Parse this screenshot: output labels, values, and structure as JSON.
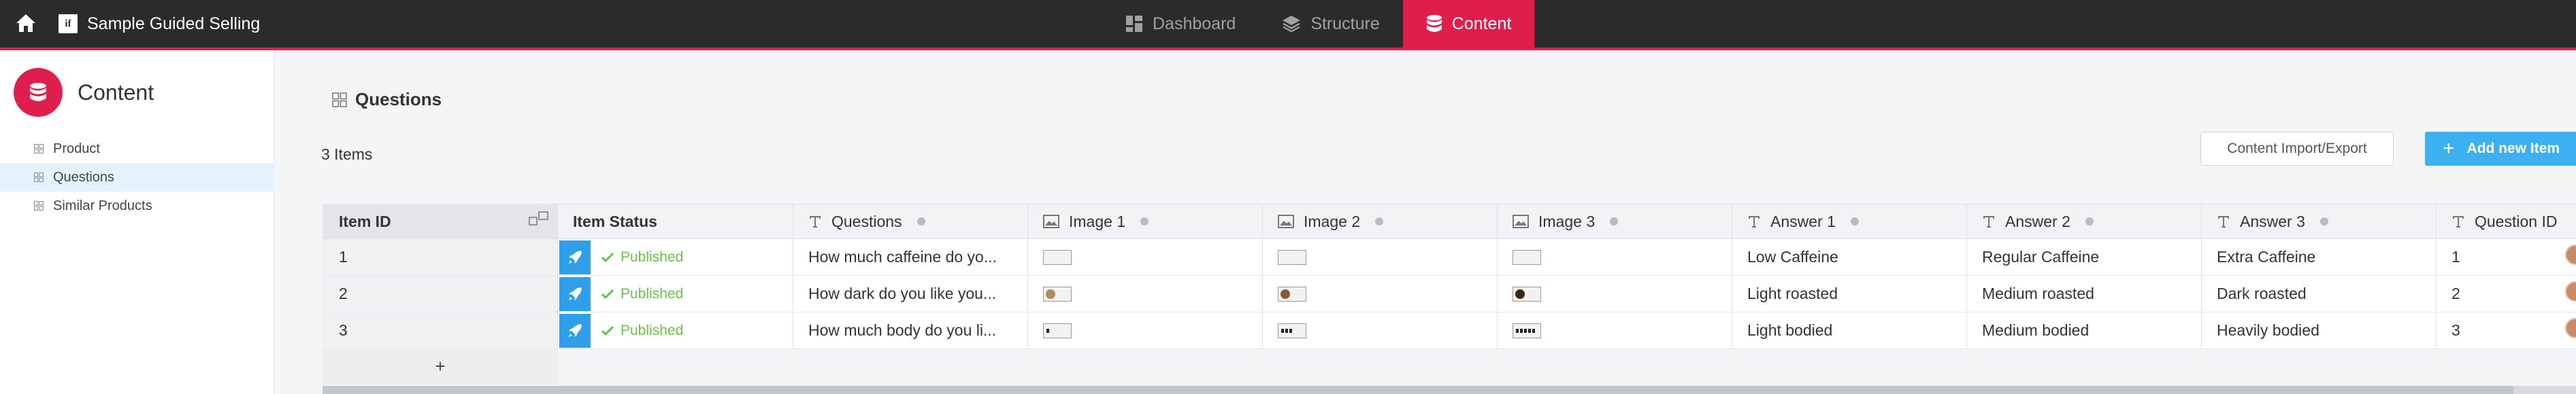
{
  "topbar": {
    "app_logo": "if",
    "app_title": "Sample Guided Selling",
    "nav": [
      {
        "label": "Dashboard",
        "icon": "dashboard-icon"
      },
      {
        "label": "Structure",
        "icon": "layers-icon"
      },
      {
        "label": "Content",
        "icon": "database-icon",
        "active": true
      }
    ]
  },
  "sidebar": {
    "title": "Content",
    "items": [
      {
        "label": "Product"
      },
      {
        "label": "Questions",
        "active": true
      },
      {
        "label": "Similar Products"
      }
    ]
  },
  "main": {
    "title": "Questions",
    "count": "3 Items",
    "import_button": "Content Import/Export",
    "add_button": "Add new Item"
  },
  "table": {
    "columns": [
      "Item ID",
      "Item Status",
      "Questions",
      "Image 1",
      "Image 2",
      "Image 3",
      "Answer 1",
      "Answer 2",
      "Answer 3",
      "Question ID"
    ],
    "rows": [
      {
        "id": "1",
        "status": "Published",
        "question": "How much caffeine do yo...",
        "a1": "Low Caffeine",
        "a2": "Regular Caffeine",
        "a3": "Extra Caffeine",
        "qid": "1"
      },
      {
        "id": "2",
        "status": "Published",
        "question": "How dark do you like you...",
        "a1": "Light roasted",
        "a2": "Medium roasted",
        "a3": "Dark roasted",
        "qid": "2"
      },
      {
        "id": "3",
        "status": "Published",
        "question": "How much body do you li...",
        "a1": "Light bodied",
        "a2": "Medium bodied",
        "a3": "Heavily bodied",
        "qid": "3"
      }
    ],
    "add_row_label": "+"
  },
  "colors": {
    "accent": "#e01e4d",
    "primary_button": "#3cb0f0",
    "published": "#6abf4b",
    "topbar": "#2b2b2b"
  }
}
